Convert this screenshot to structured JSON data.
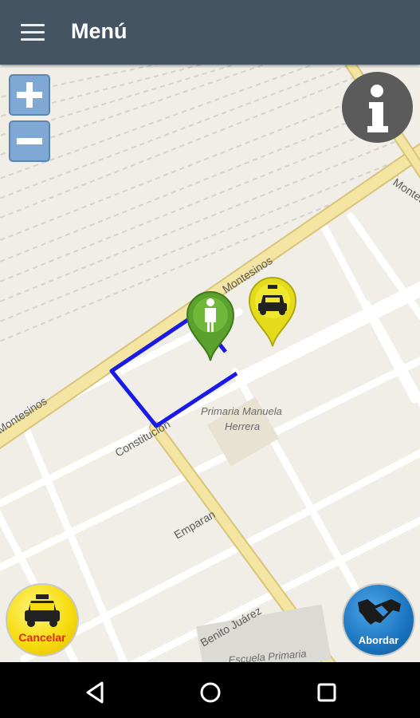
{
  "app_bar": {
    "title": "Menú",
    "menu_icon": "hamburger-icon",
    "background": "#455463"
  },
  "map": {
    "streets": {
      "montesinos_left": "Montesinos",
      "montesinos_mid": "Montesinos",
      "montesinos_right": "Montes",
      "constitucion": "Constitución",
      "emparan": "Emparan",
      "benito_juarez": "Benito Juárez"
    },
    "poi": {
      "school_line1": "Primaria Manuela",
      "school_line2": "Herrera",
      "school_bottom": "Escuela Primaria"
    },
    "controls": {
      "zoom_in_icon": "plus-icon",
      "zoom_out_icon": "minus-icon",
      "info_icon": "info-icon"
    },
    "markers": {
      "passenger_icon": "person-marker-icon",
      "taxi_icon": "taxi-marker-icon"
    },
    "route_color": "#1a1ae6"
  },
  "actions": {
    "cancel_label": "Cancelar",
    "board_label": "Abordar",
    "cancel_color": "#f6dd10",
    "board_color": "#1a74bf"
  },
  "nav_bar": {
    "back_icon": "back-triangle-icon",
    "home_icon": "home-circle-icon",
    "recents_icon": "recents-square-icon"
  }
}
